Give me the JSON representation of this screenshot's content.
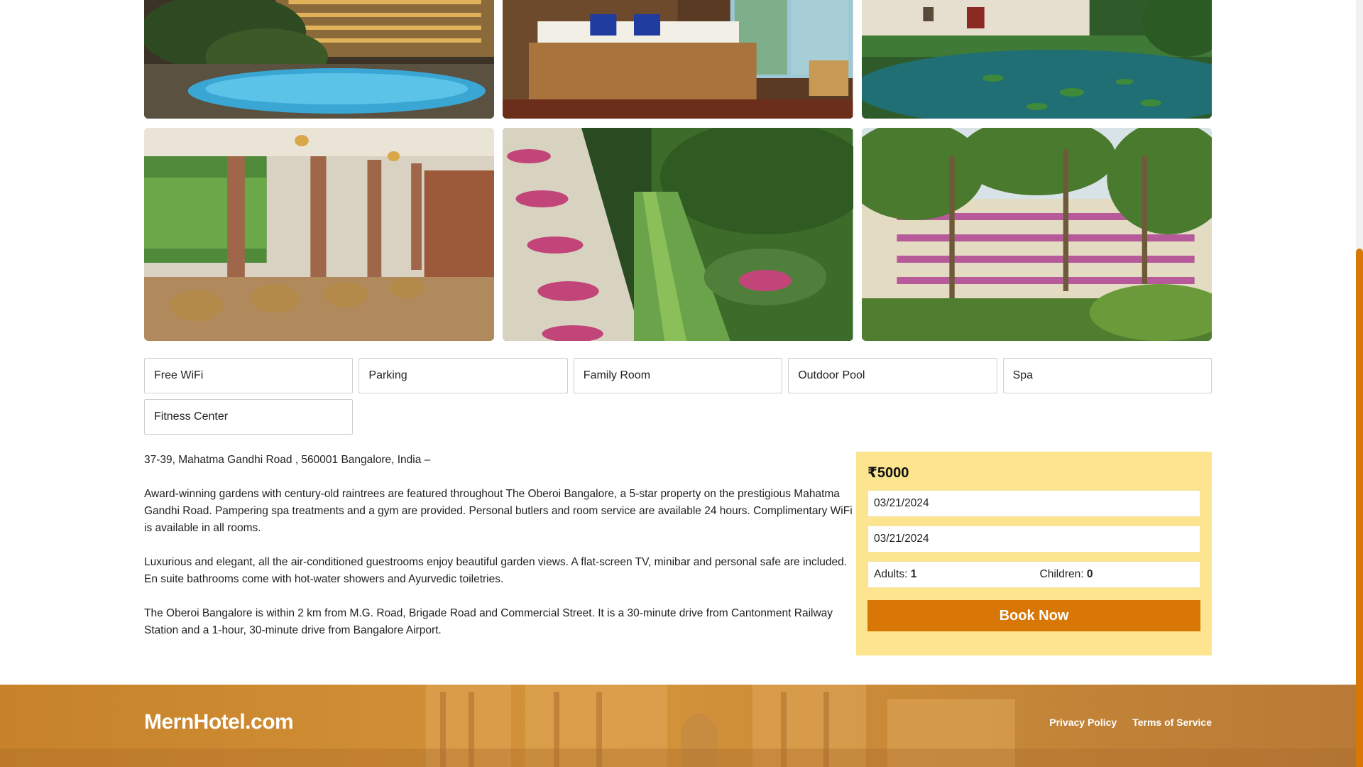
{
  "gallery": {
    "photos": [
      {
        "label": "pool-at-night"
      },
      {
        "label": "bedroom"
      },
      {
        "label": "lily-pond"
      },
      {
        "label": "terrace-restaurant"
      },
      {
        "label": "garden-walkway"
      },
      {
        "label": "hotel-facade-palms"
      }
    ]
  },
  "facilities": [
    "Free WiFi",
    "Parking",
    "Family Room",
    "Outdoor Pool",
    "Spa",
    "Fitness Center"
  ],
  "description": {
    "address": "37-39, Mahatma Gandhi Road , 560001 Bangalore, India –",
    "p1": "Award-winning gardens with century-old raintrees are featured throughout The Oberoi Bangalore, a 5-star property on the prestigious Mahatma Gandhi Road. Pampering spa treatments and a gym are provided. Personal butlers and room service are available 24 hours. Complimentary WiFi is available in all rooms.",
    "p2": "Luxurious and elegant, all the air-conditioned guestrooms enjoy beautiful garden views. A flat-screen TV, minibar and personal safe are included. En suite bathrooms come with hot-water showers and Ayurvedic toiletries.",
    "p3": "The Oberoi Bangalore is within 2 km from M.G. Road, Brigade Road and Commercial Street. It is a 30-minute drive from Cantonment Railway Station and a 1-hour, 30-minute drive from Bangalore Airport."
  },
  "booking": {
    "price": "₹5000",
    "check_in": "03/21/2024",
    "check_out": "03/21/2024",
    "adults_label": "Adults:",
    "adults_value": "1",
    "children_label": "Children:",
    "children_value": "0",
    "book_label": "Book Now"
  },
  "footer": {
    "brand": "MernHotel.com",
    "links": [
      "Privacy Policy",
      "Terms of Service"
    ]
  },
  "colors": {
    "accent": "#d97706",
    "booking_bg": "#fde58f"
  }
}
